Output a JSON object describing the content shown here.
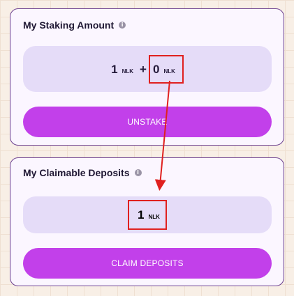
{
  "staking": {
    "title": "My Staking Amount",
    "info_glyph": "i",
    "staked_value": "1",
    "staked_unit": "NLK",
    "plus": "+",
    "pending_value": "0",
    "pending_unit": "NLK",
    "button_label": "UNSTAKE"
  },
  "claimable": {
    "title": "My Claimable Deposits",
    "info_glyph": "i",
    "value": "1",
    "unit": "NLK",
    "button_label": "CLAIM DEPOSITS"
  },
  "icons": [
    "info-icon",
    "annotation-arrow"
  ],
  "colors": {
    "accent": "#c240ea",
    "card_border": "#6b3f8f",
    "amount_box": "#e5dcf8",
    "highlight": "#e0201f"
  }
}
